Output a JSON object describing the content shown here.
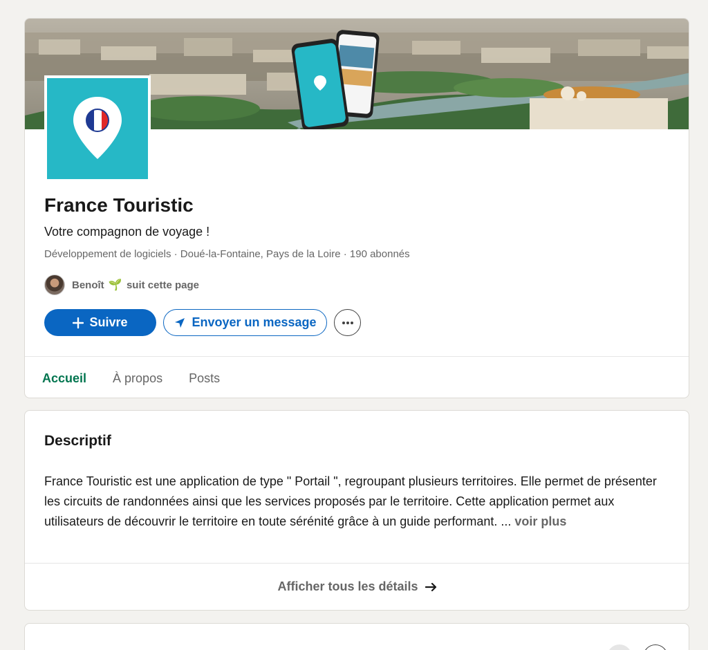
{
  "company": {
    "name": "France Touristic",
    "tagline": "Votre compagnon de voyage !",
    "meta": "Développement de logiciels · Doué-la-Fontaine, Pays de la Loire · 190 abonnés"
  },
  "follower": {
    "name": "Benoît",
    "suffix": "suit cette page",
    "emoji": "🌱"
  },
  "actions": {
    "follow_label": "Suivre",
    "message_label": "Envoyer un message"
  },
  "tabs": [
    {
      "label": "Accueil",
      "active": true
    },
    {
      "label": "À propos",
      "active": false
    },
    {
      "label": "Posts",
      "active": false
    }
  ],
  "about": {
    "title": "Descriptif",
    "text": "France Touristic est une application de type \" Portail \", regroupant plusieurs territoires. Elle permet de présenter les circuits de randonnées ainsi que les services proposés par le territoire. Cette application permet aux utilisateurs de découvrir le territoire en toute sérénité grâce à un guide performant. ...",
    "see_more": "voir plus",
    "show_all": "Afficher tous les détails"
  },
  "colors": {
    "brand_teal": "#26b8c6",
    "primary_blue": "#0a66c2",
    "active_tab_green": "#01754f"
  },
  "icons": [
    "plus-icon",
    "send-icon",
    "more-icon",
    "arrow-right-icon",
    "map-pin-icon"
  ]
}
